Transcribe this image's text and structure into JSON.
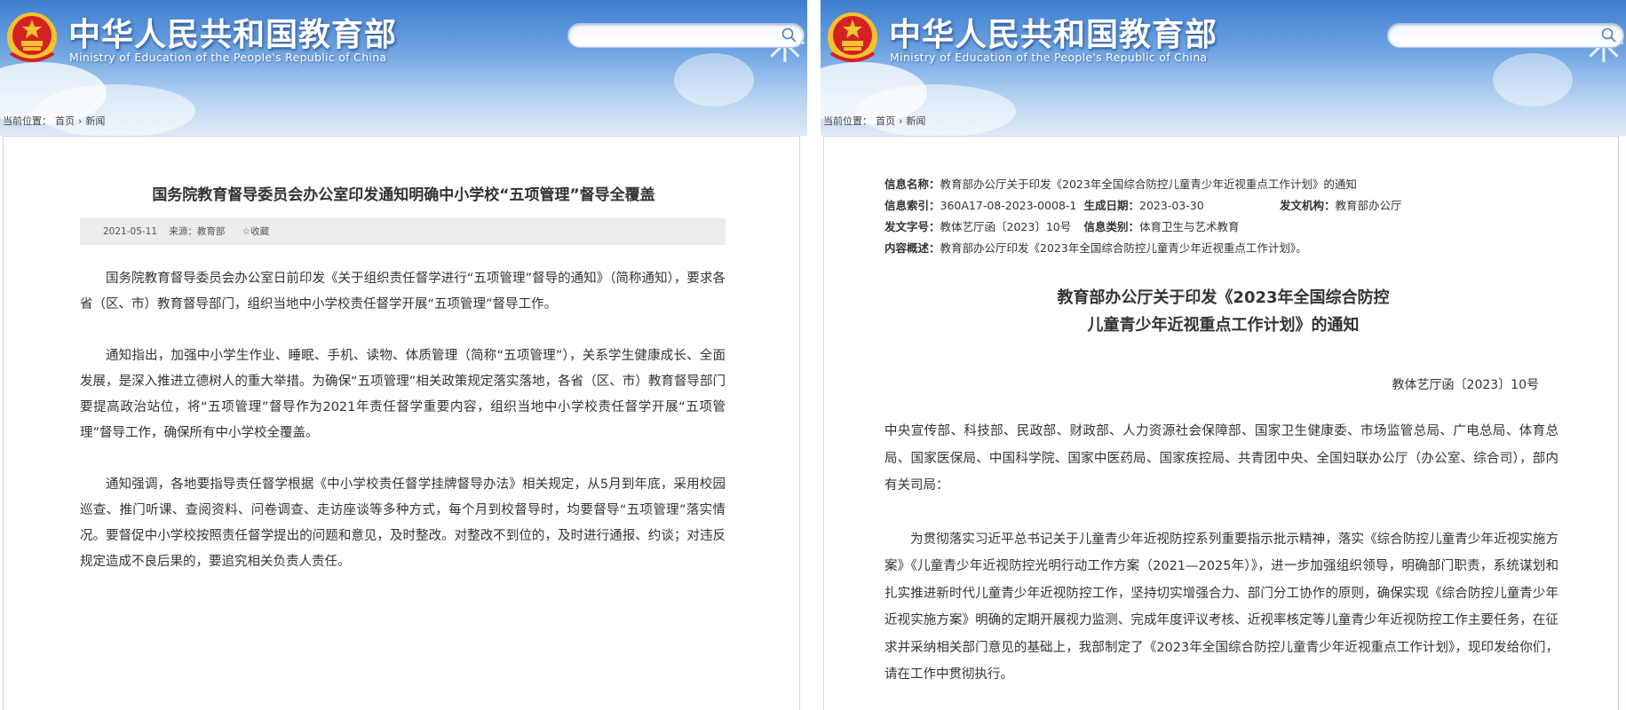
{
  "site": {
    "title": "中华人民共和国教育部",
    "subtitle": "Ministry of Education of the People's Republic of China"
  },
  "breadcrumb": {
    "label": "当前位置：",
    "home": "首页",
    "sep": "›",
    "current": "新闻"
  },
  "left_article": {
    "title": "国务院教育督导委员会办公室印发通知明确中小学校“五项管理”督导全覆盖",
    "date": "2021-05-11",
    "source": "来源：教育部",
    "favorite": "收藏",
    "paragraphs": [
      "国务院教育督导委员会办公室日前印发《关于组织责任督学进行“五项管理”督导的通知》（简称通知），要求各省（区、市）教育督导部门，组织当地中小学校责任督学开展“五项管理”督导工作。",
      "通知指出，加强中小学生作业、睡眠、手机、读物、体质管理（简称“五项管理”），关系学生健康成长、全面发展，是深入推进立德树人的重大举措。为确保“五项管理”相关政策规定落实落地，各省（区、市）教育督导部门要提高政治站位，将“五项管理”督导作为2021年责任督学重要内容，组织当地中小学校责任督学开展“五项管理”督导工作，确保所有中小学校全覆盖。",
      "通知强调，各地要指导责任督学根据《中小学校责任督学挂牌督导办法》相关规定，从5月到年底，采用校园巡查、推门听课、查阅资料、问卷调查、走访座谈等多种方式，每个月到校督导时，均要督导“五项管理”落实情况。要督促中小学校按照责任督学提出的问题和意见，及时整改。对整改不到位的，及时进行通报、约谈；对违反规定造成不良后果的，要追究相关负责人责任。"
    ]
  },
  "right_article": {
    "info": {
      "name_label": "信息名称：",
      "name_value": "教育部办公厅关于印发《2023年全国综合防控儿童青少年近视重点工作计划》的通知",
      "index_label": "信息索引：",
      "index_value": "360A17-08-2023-0008-1",
      "date_label": "生成日期：",
      "date_value": "2023-03-30",
      "org_label": "发文机构：",
      "org_value": "教育部办公厅",
      "docno_label": "发文字号：",
      "docno_value": "教体艺厅函〔2023〕10号",
      "category_label": "信息类别：",
      "category_value": "体育卫生与艺术教育",
      "summary_label": "内容概述：",
      "summary_value": "教育部办公厅印发《2023年全国综合防控儿童青少年近视重点工作计划》。"
    },
    "title_line1": "教育部办公厅关于印发《2023年全国综合防控",
    "title_line2": "儿童青少年近视重点工作计划》的通知",
    "doc_no": "教体艺厅函〔2023〕10号",
    "paragraphs": [
      "中央宣传部、科技部、民政部、财政部、人力资源社会保障部、国家卫生健康委、市场监管总局、广电总局、体育总局、国家医保局、中国科学院、国家中医药局、国家疾控局、共青团中央、全国妇联办公厅（办公室、综合司），部内有关司局：",
      "为贯彻落实习近平总书记关于儿童青少年近视防控系列重要指示批示精神，落实《综合防控儿童青少年近视实施方案》《儿童青少年近视防控光明行动工作方案（2021—2025年）》，进一步加强组织领导，明确部门职责，系统谋划和扎实推进新时代儿童青少年近视防控工作，坚持切实增强合力、部门分工协作的原则，确保实现《综合防控儿童青少年近视实施方案》明确的定期开展视力监测、完成年度评议考核、近视率核定等儿童青少年近视防控工作主要任务，在征求并采纳相关部门意见的基础上，我部制定了《2023年全国综合防控儿童青少年近视重点工作计划》，现印发给你们，请在工作中贯彻执行。"
    ]
  },
  "colors": {
    "banner_top": "#3f7fd0",
    "banner_bottom": "#dfeaf6",
    "emblem_red": "#d42121",
    "emblem_gold": "#f2c230"
  },
  "icons": [
    "national-emblem-icon",
    "search-icon",
    "star-icon"
  ]
}
